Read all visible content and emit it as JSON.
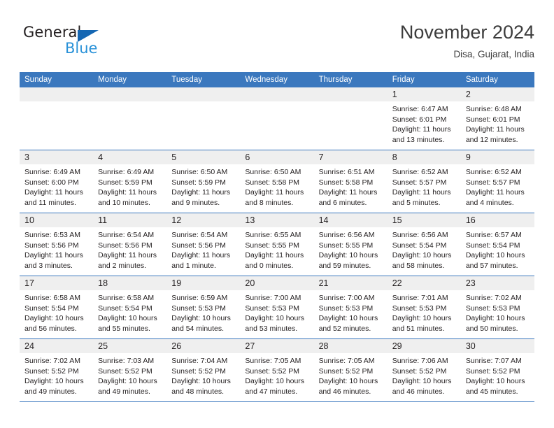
{
  "logo": {
    "word_top": "General",
    "word_bottom": "Blue",
    "triangle_color": "#1567b3",
    "bottom_color": "#2a92d8"
  },
  "header": {
    "title": "November 2024",
    "subtitle": "Disa, Gujarat, India"
  },
  "theme": {
    "header_blue": "#3b78be",
    "day_band_gray": "#efefef",
    "text": "#231f20"
  },
  "weekday_headers": [
    "Sunday",
    "Monday",
    "Tuesday",
    "Wednesday",
    "Thursday",
    "Friday",
    "Saturday"
  ],
  "weeks": [
    [
      {
        "day": "",
        "empty": true
      },
      {
        "day": "",
        "empty": true
      },
      {
        "day": "",
        "empty": true
      },
      {
        "day": "",
        "empty": true
      },
      {
        "day": "",
        "empty": true
      },
      {
        "day": "1",
        "sunrise": "Sunrise: 6:47 AM",
        "sunset": "Sunset: 6:01 PM",
        "daylight": "Daylight: 11 hours and 13 minutes."
      },
      {
        "day": "2",
        "sunrise": "Sunrise: 6:48 AM",
        "sunset": "Sunset: 6:01 PM",
        "daylight": "Daylight: 11 hours and 12 minutes."
      }
    ],
    [
      {
        "day": "3",
        "sunrise": "Sunrise: 6:49 AM",
        "sunset": "Sunset: 6:00 PM",
        "daylight": "Daylight: 11 hours and 11 minutes."
      },
      {
        "day": "4",
        "sunrise": "Sunrise: 6:49 AM",
        "sunset": "Sunset: 5:59 PM",
        "daylight": "Daylight: 11 hours and 10 minutes."
      },
      {
        "day": "5",
        "sunrise": "Sunrise: 6:50 AM",
        "sunset": "Sunset: 5:59 PM",
        "daylight": "Daylight: 11 hours and 9 minutes."
      },
      {
        "day": "6",
        "sunrise": "Sunrise: 6:50 AM",
        "sunset": "Sunset: 5:58 PM",
        "daylight": "Daylight: 11 hours and 8 minutes."
      },
      {
        "day": "7",
        "sunrise": "Sunrise: 6:51 AM",
        "sunset": "Sunset: 5:58 PM",
        "daylight": "Daylight: 11 hours and 6 minutes."
      },
      {
        "day": "8",
        "sunrise": "Sunrise: 6:52 AM",
        "sunset": "Sunset: 5:57 PM",
        "daylight": "Daylight: 11 hours and 5 minutes."
      },
      {
        "day": "9",
        "sunrise": "Sunrise: 6:52 AM",
        "sunset": "Sunset: 5:57 PM",
        "daylight": "Daylight: 11 hours and 4 minutes."
      }
    ],
    [
      {
        "day": "10",
        "sunrise": "Sunrise: 6:53 AM",
        "sunset": "Sunset: 5:56 PM",
        "daylight": "Daylight: 11 hours and 3 minutes."
      },
      {
        "day": "11",
        "sunrise": "Sunrise: 6:54 AM",
        "sunset": "Sunset: 5:56 PM",
        "daylight": "Daylight: 11 hours and 2 minutes."
      },
      {
        "day": "12",
        "sunrise": "Sunrise: 6:54 AM",
        "sunset": "Sunset: 5:56 PM",
        "daylight": "Daylight: 11 hours and 1 minute."
      },
      {
        "day": "13",
        "sunrise": "Sunrise: 6:55 AM",
        "sunset": "Sunset: 5:55 PM",
        "daylight": "Daylight: 11 hours and 0 minutes."
      },
      {
        "day": "14",
        "sunrise": "Sunrise: 6:56 AM",
        "sunset": "Sunset: 5:55 PM",
        "daylight": "Daylight: 10 hours and 59 minutes."
      },
      {
        "day": "15",
        "sunrise": "Sunrise: 6:56 AM",
        "sunset": "Sunset: 5:54 PM",
        "daylight": "Daylight: 10 hours and 58 minutes."
      },
      {
        "day": "16",
        "sunrise": "Sunrise: 6:57 AM",
        "sunset": "Sunset: 5:54 PM",
        "daylight": "Daylight: 10 hours and 57 minutes."
      }
    ],
    [
      {
        "day": "17",
        "sunrise": "Sunrise: 6:58 AM",
        "sunset": "Sunset: 5:54 PM",
        "daylight": "Daylight: 10 hours and 56 minutes."
      },
      {
        "day": "18",
        "sunrise": "Sunrise: 6:58 AM",
        "sunset": "Sunset: 5:54 PM",
        "daylight": "Daylight: 10 hours and 55 minutes."
      },
      {
        "day": "19",
        "sunrise": "Sunrise: 6:59 AM",
        "sunset": "Sunset: 5:53 PM",
        "daylight": "Daylight: 10 hours and 54 minutes."
      },
      {
        "day": "20",
        "sunrise": "Sunrise: 7:00 AM",
        "sunset": "Sunset: 5:53 PM",
        "daylight": "Daylight: 10 hours and 53 minutes."
      },
      {
        "day": "21",
        "sunrise": "Sunrise: 7:00 AM",
        "sunset": "Sunset: 5:53 PM",
        "daylight": "Daylight: 10 hours and 52 minutes."
      },
      {
        "day": "22",
        "sunrise": "Sunrise: 7:01 AM",
        "sunset": "Sunset: 5:53 PM",
        "daylight": "Daylight: 10 hours and 51 minutes."
      },
      {
        "day": "23",
        "sunrise": "Sunrise: 7:02 AM",
        "sunset": "Sunset: 5:53 PM",
        "daylight": "Daylight: 10 hours and 50 minutes."
      }
    ],
    [
      {
        "day": "24",
        "sunrise": "Sunrise: 7:02 AM",
        "sunset": "Sunset: 5:52 PM",
        "daylight": "Daylight: 10 hours and 49 minutes."
      },
      {
        "day": "25",
        "sunrise": "Sunrise: 7:03 AM",
        "sunset": "Sunset: 5:52 PM",
        "daylight": "Daylight: 10 hours and 49 minutes."
      },
      {
        "day": "26",
        "sunrise": "Sunrise: 7:04 AM",
        "sunset": "Sunset: 5:52 PM",
        "daylight": "Daylight: 10 hours and 48 minutes."
      },
      {
        "day": "27",
        "sunrise": "Sunrise: 7:05 AM",
        "sunset": "Sunset: 5:52 PM",
        "daylight": "Daylight: 10 hours and 47 minutes."
      },
      {
        "day": "28",
        "sunrise": "Sunrise: 7:05 AM",
        "sunset": "Sunset: 5:52 PM",
        "daylight": "Daylight: 10 hours and 46 minutes."
      },
      {
        "day": "29",
        "sunrise": "Sunrise: 7:06 AM",
        "sunset": "Sunset: 5:52 PM",
        "daylight": "Daylight: 10 hours and 46 minutes."
      },
      {
        "day": "30",
        "sunrise": "Sunrise: 7:07 AM",
        "sunset": "Sunset: 5:52 PM",
        "daylight": "Daylight: 10 hours and 45 minutes."
      }
    ]
  ]
}
